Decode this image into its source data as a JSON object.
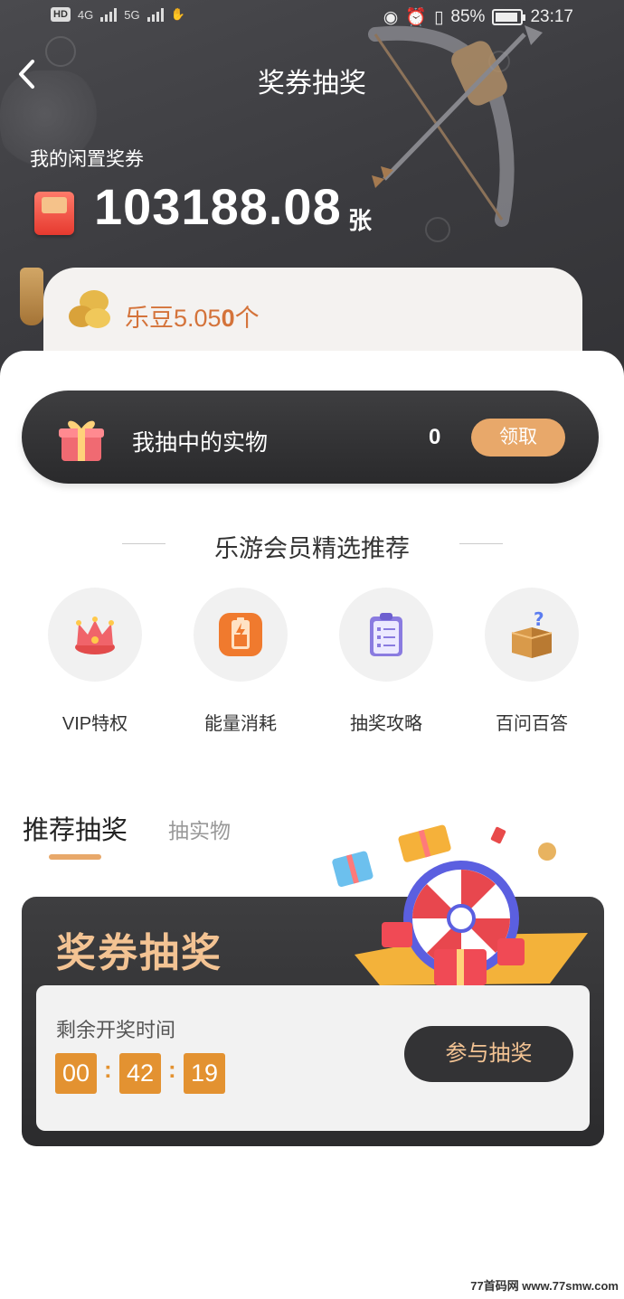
{
  "status_bar": {
    "left_tags": [
      "HD",
      "4G",
      "5G"
    ],
    "battery": "85%",
    "time": "23:17"
  },
  "header": {
    "back_icon": "chevron-left-icon",
    "title": "奖券抽奖"
  },
  "voucher": {
    "label": "我的闲置奖券",
    "amount": "103188.08",
    "unit": "张"
  },
  "ledou": {
    "prefix": "乐豆5.05",
    "bold": "0",
    "suffix": "个"
  },
  "prize_bar": {
    "label": "我抽中的实物",
    "count": "0",
    "claim_label": "领取"
  },
  "recommend": {
    "title": "乐游会员精选推荐",
    "items": [
      {
        "label": "VIP特权",
        "icon": "crown-icon"
      },
      {
        "label": "能量消耗",
        "icon": "battery-icon"
      },
      {
        "label": "抽奖攻略",
        "icon": "clipboard-icon"
      },
      {
        "label": "百问百答",
        "icon": "question-box-icon"
      }
    ]
  },
  "tabs": [
    {
      "label": "推荐抽奖",
      "active": true
    },
    {
      "label": "抽实物",
      "active": false
    }
  ],
  "lottery": {
    "title": "奖券抽奖",
    "remain_label": "剩余开奖时间",
    "hours": "00",
    "minutes": "42",
    "seconds": "19",
    "separator": ":",
    "join_label": "参与抽奖"
  },
  "watermark": "77首码网 www.77smw.com",
  "colors": {
    "accent": "#e8a86a",
    "timer": "#e39231",
    "dark": "#333335",
    "gold_text": "#f3c393"
  }
}
